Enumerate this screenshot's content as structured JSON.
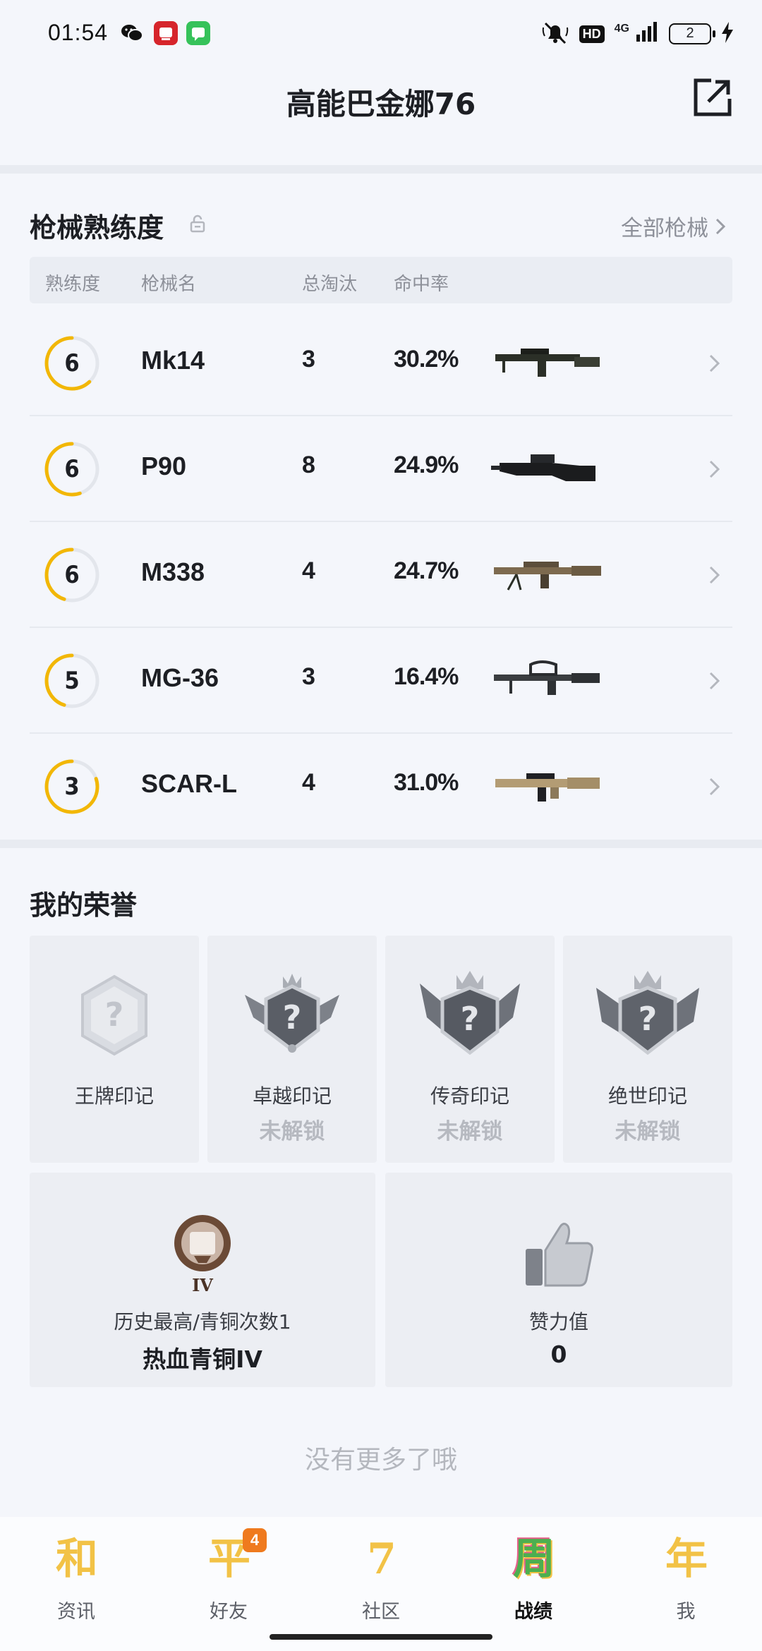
{
  "status_bar": {
    "time": "01:54",
    "network": "4G",
    "battery": "2"
  },
  "header": {
    "title": "高能巴金娜76"
  },
  "weapons": {
    "section_title": "枪械熟练度",
    "all_link": "全部枪械",
    "columns": {
      "mastery": "熟练度",
      "name": "枪械名",
      "kills": "总淘汰",
      "accuracy": "命中率"
    },
    "rows": [
      {
        "level": "6",
        "name": "Mk14",
        "kills": "3",
        "accuracy": "30.2%",
        "progress": 0.62
      },
      {
        "level": "6",
        "name": "P90",
        "kills": "8",
        "accuracy": "24.9%",
        "progress": 0.55
      },
      {
        "level": "6",
        "name": "M338",
        "kills": "4",
        "accuracy": "24.7%",
        "progress": 0.45
      },
      {
        "level": "5",
        "name": "MG-36",
        "kills": "3",
        "accuracy": "16.4%",
        "progress": 0.45
      },
      {
        "level": "3",
        "name": "SCAR-L",
        "kills": "4",
        "accuracy": "31.0%",
        "progress": 0.8
      }
    ]
  },
  "honors": {
    "section_title": "我的荣誉",
    "cards": [
      {
        "name": "王牌印记",
        "status": ""
      },
      {
        "name": "卓越印记",
        "status": "未解锁"
      },
      {
        "name": "传奇印记",
        "status": "未解锁"
      },
      {
        "name": "绝世印记",
        "status": "未解锁"
      }
    ],
    "rank": {
      "label": "历史最高/青铜次数1",
      "value": "热血青铜IV",
      "tier": "IV"
    },
    "likes": {
      "label": "赞力值",
      "value": "0"
    }
  },
  "footer": {
    "no_more": "没有更多了哦"
  },
  "nav": {
    "items": [
      {
        "glyph": "和",
        "label": "资讯",
        "badge": ""
      },
      {
        "glyph": "平",
        "label": "好友",
        "badge": "4"
      },
      {
        "glyph": "7",
        "label": "社区",
        "badge": ""
      },
      {
        "glyph": "周",
        "label": "战绩",
        "badge": ""
      },
      {
        "glyph": "年",
        "label": "我",
        "badge": ""
      }
    ],
    "active_index": 3
  },
  "colors": {
    "accent": "#f2b705",
    "ring_track": "#e3e6ec",
    "muted": "#8d9099"
  }
}
